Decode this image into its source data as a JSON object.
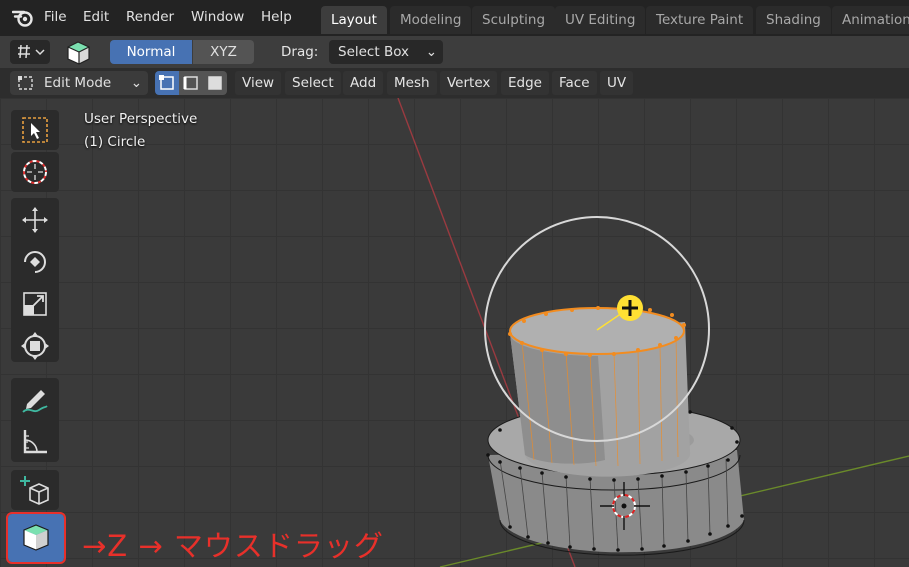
{
  "menubar": {
    "items": [
      "File",
      "Edit",
      "Render",
      "Window",
      "Help"
    ]
  },
  "workspaces": {
    "tabs": [
      "Layout",
      "Modeling",
      "Sculpting",
      "UV Editing",
      "Texture Paint",
      "Shading",
      "Animation"
    ],
    "active": "Layout"
  },
  "header1": {
    "normal_label": "Normal",
    "xyz_label": "XYZ",
    "drag_label": "Drag:",
    "drag_value": "Select Box"
  },
  "header2": {
    "mode": "Edit Mode",
    "menus": [
      "View",
      "Select",
      "Add",
      "Mesh",
      "Vertex",
      "Edge",
      "Face",
      "UV"
    ]
  },
  "viewport": {
    "perspective_label": "User Perspective",
    "object_label": "(1) Circle"
  },
  "toolbar": {
    "tools": [
      "select-box",
      "cursor",
      "move",
      "rotate",
      "scale",
      "transform",
      "annotate",
      "measure",
      "add-cube",
      "extrude-region"
    ],
    "active": "extrude-region"
  },
  "annotation": {
    "text": "→Z → マウスドラッグ",
    "color": "#e8302a"
  },
  "colors": {
    "accent": "#4772b3",
    "selection": "#f28c20",
    "gizmo": "#ffe033"
  }
}
